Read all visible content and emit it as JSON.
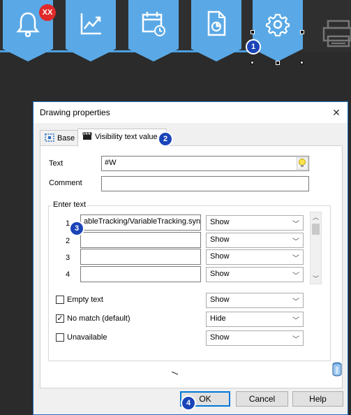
{
  "toolbar": {
    "alerts_badge": "XX",
    "buttons": [
      {
        "icon": "bell-icon"
      },
      {
        "icon": "trend-chart-icon"
      },
      {
        "icon": "calendar-clock-icon"
      },
      {
        "icon": "report-document-icon"
      },
      {
        "icon": "gear-icon"
      },
      {
        "icon": "printer-icon"
      }
    ]
  },
  "callouts": {
    "c1": "1",
    "c2": "2",
    "c3": "3",
    "c4": "4"
  },
  "dialog": {
    "title": "Drawing properties",
    "close_glyph": "✕",
    "tabs": [
      {
        "label": "Base",
        "icon": "base-icon"
      },
      {
        "label": "Visibility text value",
        "icon": "clapper-icon"
      }
    ],
    "text_label": "Text",
    "text_value": "#W",
    "comment_label": "Comment",
    "comment_value": "",
    "enter_text_group": "Enter text",
    "rows": [
      {
        "num": "1",
        "text": "ableTracking/VariableTracking.syn",
        "visibility": "Show"
      },
      {
        "num": "2",
        "text": "",
        "visibility": "Show"
      },
      {
        "num": "3",
        "text": "",
        "visibility": "Show"
      },
      {
        "num": "4",
        "text": "",
        "visibility": "Show"
      }
    ],
    "options": [
      {
        "label": "Empty text",
        "checked": false,
        "check_glyph": "",
        "visibility": "Show"
      },
      {
        "label": "No match (default)",
        "checked": true,
        "check_glyph": "✓",
        "visibility": "Hide"
      },
      {
        "label": "Unavailable",
        "checked": false,
        "check_glyph": "",
        "visibility": "Show"
      }
    ],
    "buttons": {
      "ok": "OK",
      "cancel": "Cancel",
      "help": "Help"
    }
  },
  "colors": {
    "accent": "#5aa9e6",
    "badge_red": "#e02a2a",
    "callout_blue": "#1a44b8",
    "focus_blue": "#0078d7"
  }
}
